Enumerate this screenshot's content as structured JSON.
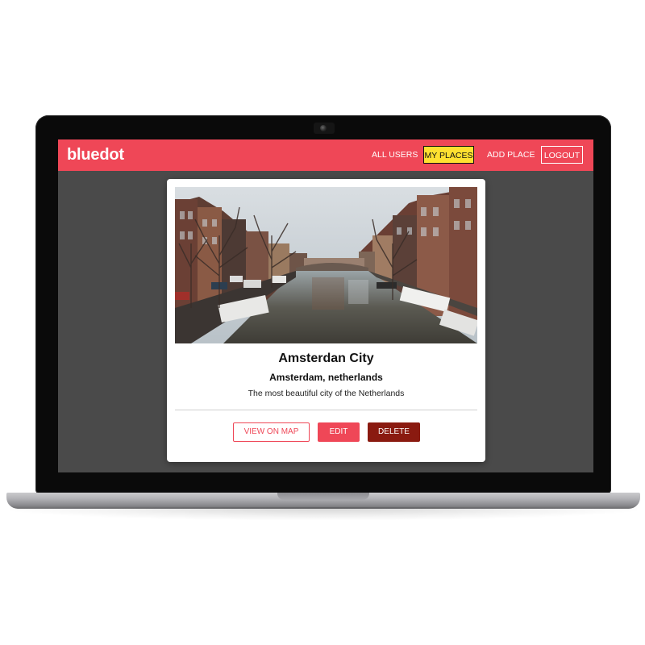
{
  "app": {
    "brand": "bluedot",
    "accent_color": "#ef4757",
    "active_nav_color": "#ffe030",
    "delete_color": "#8a1a10"
  },
  "navbar": {
    "links": [
      {
        "label": "ALL USERS",
        "active": false
      },
      {
        "label": "MY PLACES",
        "active": true
      },
      {
        "label": "ADD PLACE",
        "active": false
      },
      {
        "label": "LOGOUT",
        "active": false
      }
    ]
  },
  "place": {
    "image_icon": "canal-photo",
    "title": "Amsterdan City",
    "address": "Amsterdam, netherlands",
    "description": "The most beautiful city of the Netherlands",
    "actions": {
      "view_on_map": "VIEW ON MAP",
      "edit": "EDIT",
      "delete": "DELETE"
    }
  }
}
